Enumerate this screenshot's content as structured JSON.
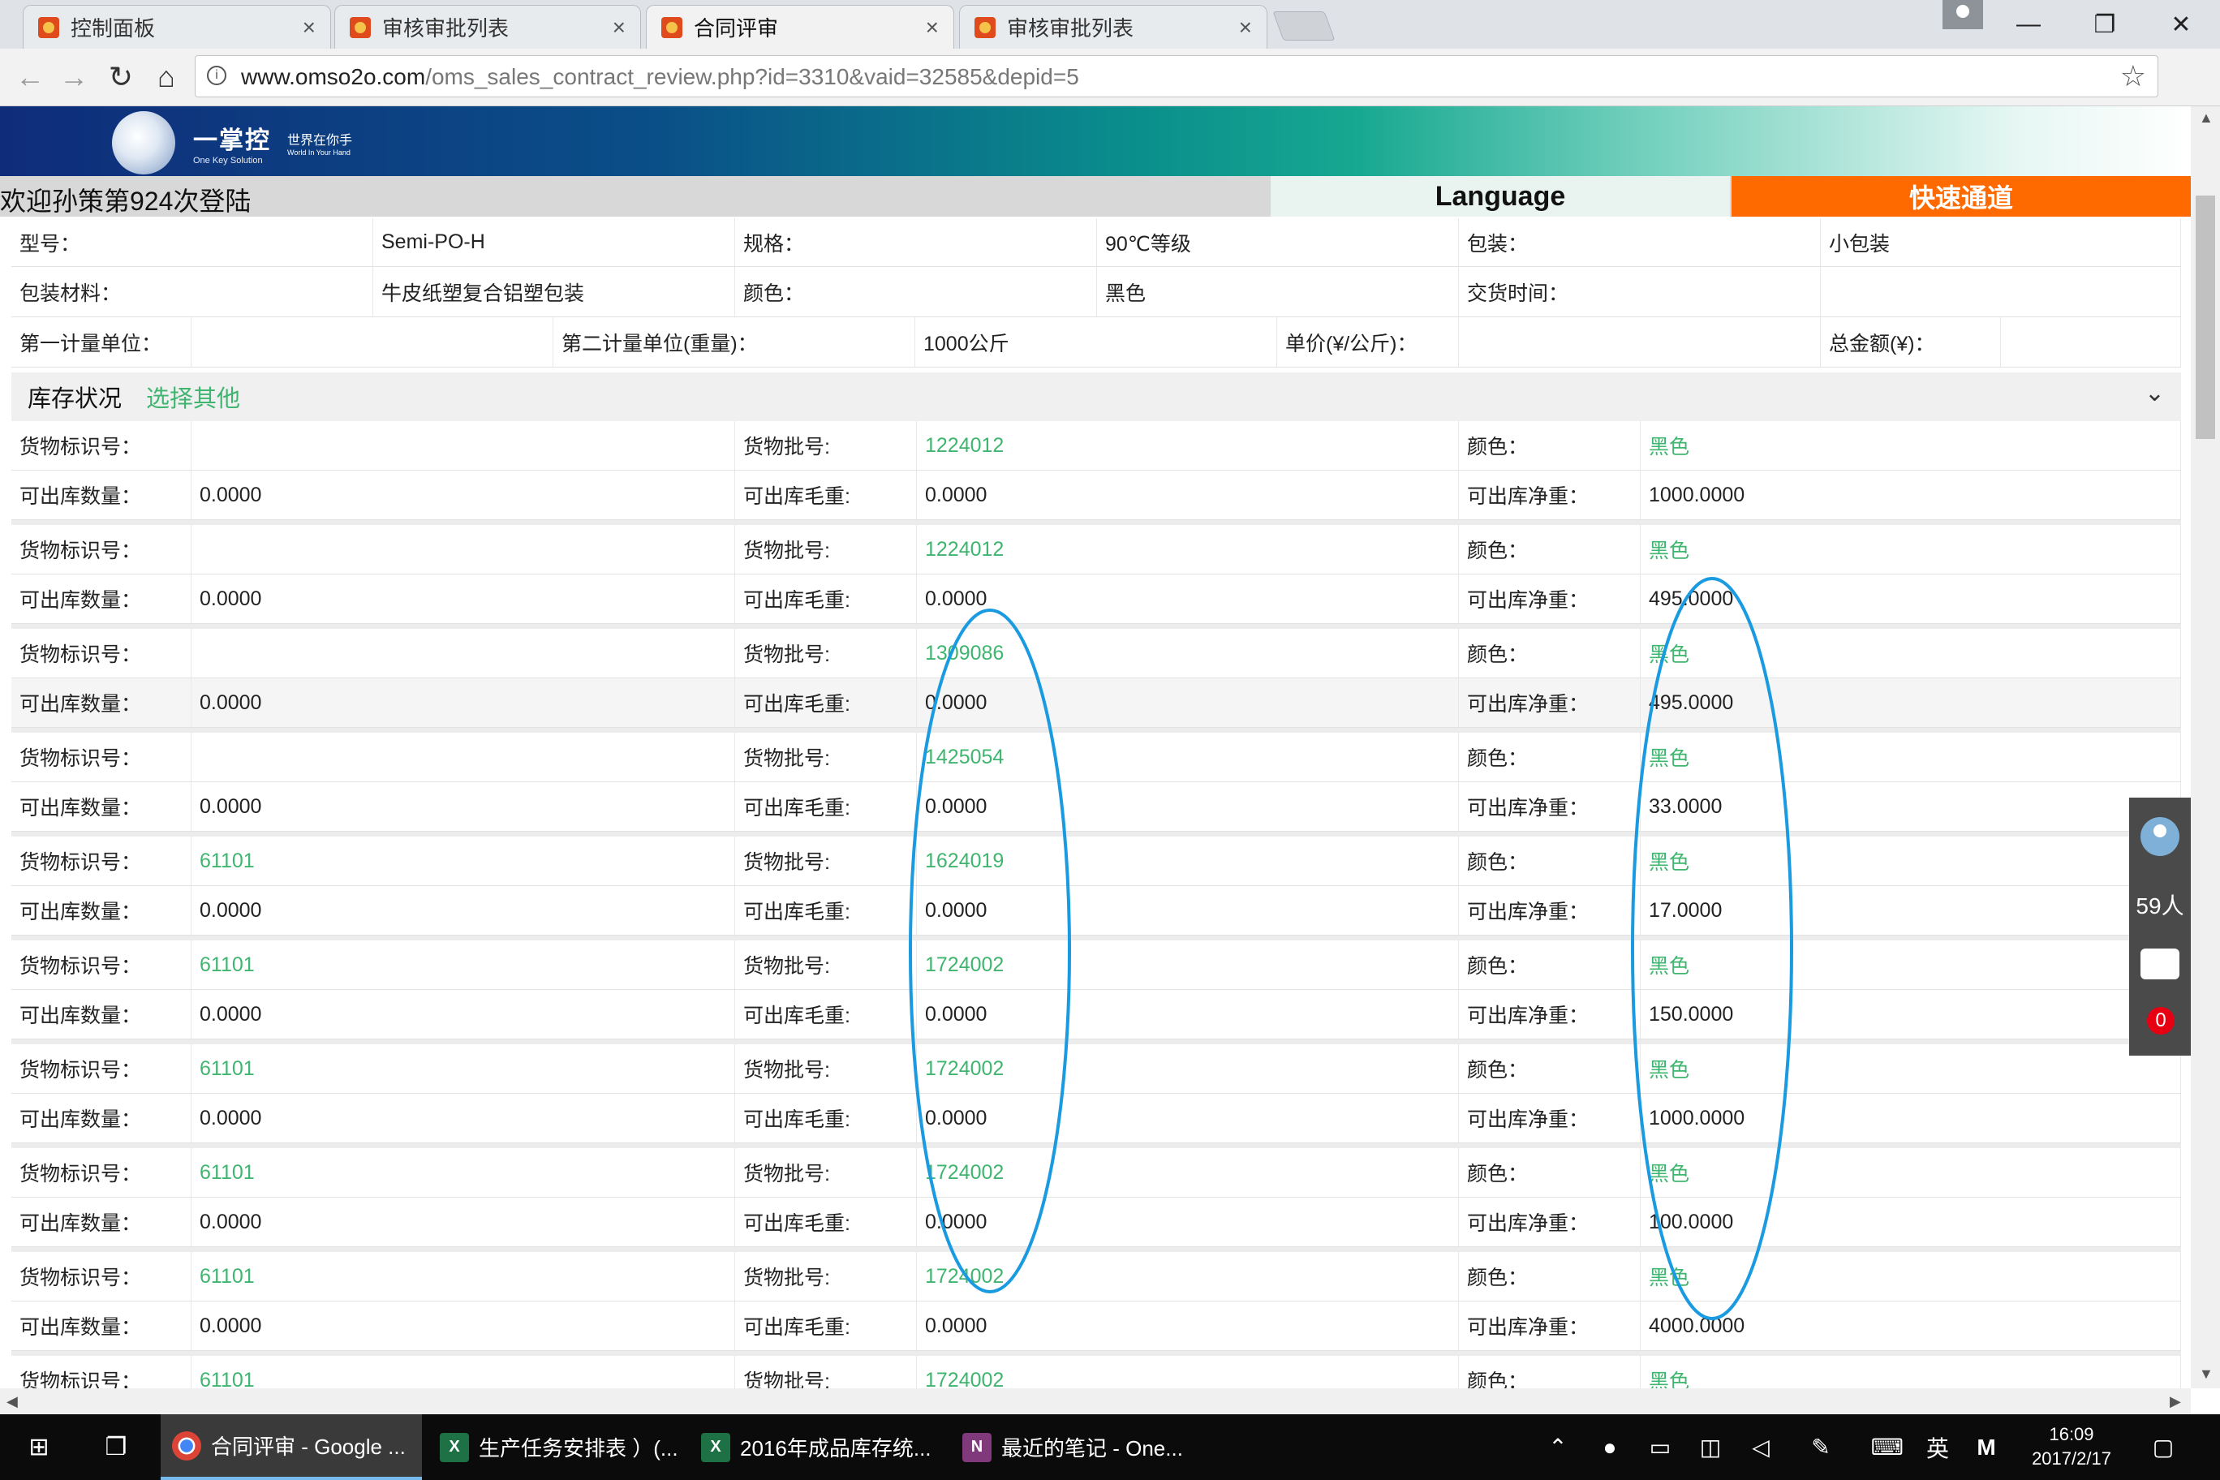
{
  "browser": {
    "tabs": [
      {
        "label": "控制面板",
        "active": false
      },
      {
        "label": "审核审批列表",
        "active": false
      },
      {
        "label": "合同评审",
        "active": true
      },
      {
        "label": "审核审批列表",
        "active": false
      }
    ],
    "url_host": "www.omso2o.com",
    "url_rest": "/oms_sales_contract_review.php?id=3310&vaid=32585&depid=5",
    "close_glyph": "×"
  },
  "header": {
    "brand_cn": "一掌控",
    "brand_en": "One Key Solution",
    "slogan_cn": "世界在你手",
    "slogan_en": "World In Your Hand",
    "welcome": "欢迎孙策第924次登陆",
    "language_label": "Language",
    "quick_label": "快速通道"
  },
  "product": {
    "row1": [
      "型号：",
      "Semi-PO-H",
      "规格：",
      "90℃等级",
      "包装：",
      "小包装"
    ],
    "row2": [
      "包装材料：",
      "牛皮纸塑复合铝塑包装",
      "颜色：",
      "黑色",
      "交货时间：",
      ""
    ],
    "row3": [
      "第一计量单位：",
      "",
      "第二计量单位(重量)：",
      "1000公斤",
      "单价(¥/公斤)：",
      "",
      "总金额(¥)：",
      ""
    ]
  },
  "inventory": {
    "title": "库存状况",
    "select_other": "选择其他",
    "labels": {
      "id": "货物标识号：",
      "batch": "货物批号:",
      "color": "颜色：",
      "qty": "可出库数量：",
      "gross": "可出库毛重:",
      "net": "可出库净重："
    },
    "records": [
      {
        "id": "",
        "batch": "1224012",
        "color": "黑色",
        "qty": "0.0000",
        "gross": "0.0000",
        "net": "1000.0000"
      },
      {
        "id": "",
        "batch": "1224012",
        "color": "黑色",
        "qty": "0.0000",
        "gross": "0.0000",
        "net": "495.0000"
      },
      {
        "id": "",
        "batch": "1309086",
        "color": "黑色",
        "qty": "0.0000",
        "gross": "0.0000",
        "net": "495.0000"
      },
      {
        "id": "",
        "batch": "1425054",
        "color": "黑色",
        "qty": "0.0000",
        "gross": "0.0000",
        "net": "33.0000"
      },
      {
        "id": "61101",
        "batch": "1624019",
        "color": "黑色",
        "qty": "0.0000",
        "gross": "0.0000",
        "net": "17.0000"
      },
      {
        "id": "61101",
        "batch": "1724002",
        "color": "黑色",
        "qty": "0.0000",
        "gross": "0.0000",
        "net": "150.0000"
      },
      {
        "id": "61101",
        "batch": "1724002",
        "color": "黑色",
        "qty": "0.0000",
        "gross": "0.0000",
        "net": "1000.0000"
      },
      {
        "id": "61101",
        "batch": "1724002",
        "color": "黑色",
        "qty": "0.0000",
        "gross": "0.0000",
        "net": "100.0000"
      },
      {
        "id": "61101",
        "batch": "1724002",
        "color": "黑色",
        "qty": "0.0000",
        "gross": "0.0000",
        "net": "4000.0000"
      },
      {
        "id": "61101",
        "batch": "1724002",
        "color": "黑色",
        "qty": "",
        "gross": "",
        "net": ""
      }
    ]
  },
  "widget": {
    "online": "59人",
    "unread": "0"
  },
  "taskbar": {
    "apps": [
      {
        "label": "合同评审 - Google ...",
        "icon": "chrome-icon",
        "active": true
      },
      {
        "label": "生产任务安排表 ）(...",
        "icon": "excel-icon",
        "active": false
      },
      {
        "label": "2016年成品库存统...",
        "icon": "excel-icon",
        "active": false
      },
      {
        "label": "最近的笔记 - One...",
        "icon": "onenote-icon",
        "active": false
      }
    ],
    "ime": "英",
    "ime2": "M",
    "time": "16:09",
    "date": "2017/2/17"
  },
  "colors": {
    "accent_green": "#3fb56f",
    "quick_orange": "#ff6a00",
    "annotation_blue": "#1a9ae0"
  }
}
